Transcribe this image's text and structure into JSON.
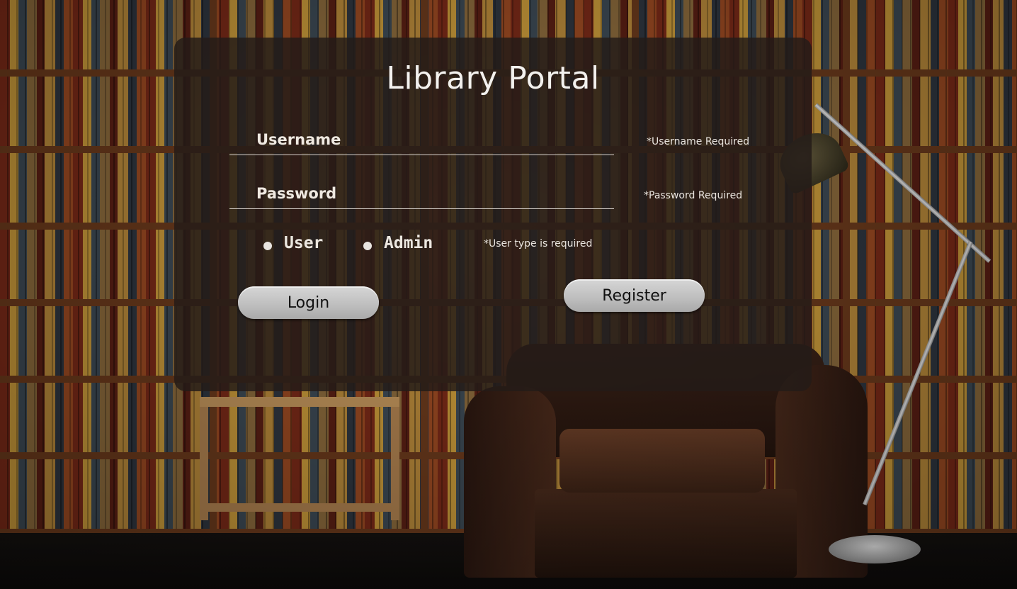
{
  "page": {
    "title": "Library Portal"
  },
  "form": {
    "username": {
      "placeholder": "Username",
      "value": "",
      "error": "*Username Required"
    },
    "password": {
      "placeholder": "Password",
      "value": "",
      "error": "*Password Required"
    },
    "user_type": {
      "options": [
        {
          "label": "User",
          "selected": false
        },
        {
          "label": "Admin",
          "selected": false
        }
      ],
      "error": "*User type is required"
    },
    "login_label": "Login",
    "register_label": "Register"
  },
  "colors": {
    "card_background": "#241c18",
    "text": "#f3f1ee",
    "button": "#c4c4c4"
  }
}
